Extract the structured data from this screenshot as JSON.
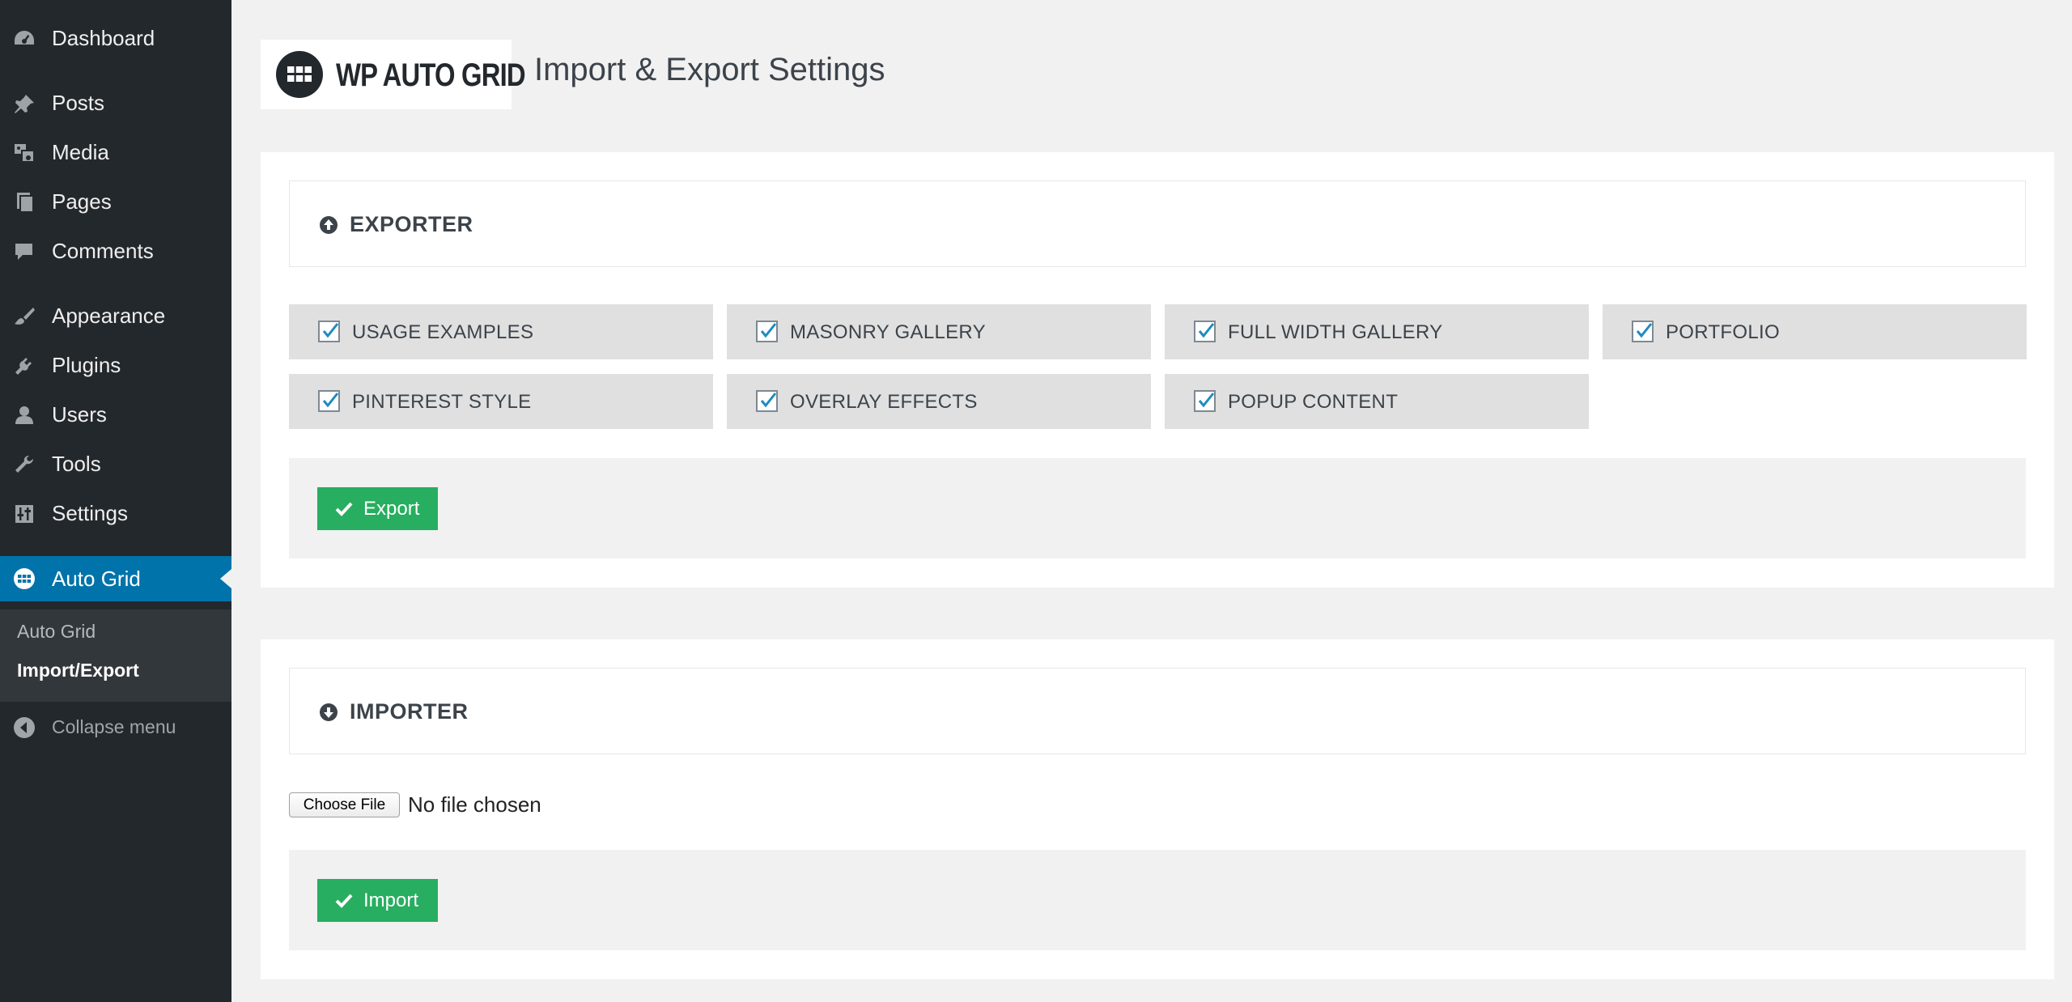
{
  "sidebar": {
    "items": [
      {
        "label": "Dashboard",
        "icon": "dashboard-icon"
      },
      {
        "label": "Posts",
        "icon": "pin-icon"
      },
      {
        "label": "Media",
        "icon": "media-icon"
      },
      {
        "label": "Pages",
        "icon": "pages-icon"
      },
      {
        "label": "Comments",
        "icon": "comment-icon"
      },
      {
        "label": "Appearance",
        "icon": "brush-icon"
      },
      {
        "label": "Plugins",
        "icon": "plug-icon"
      },
      {
        "label": "Users",
        "icon": "user-icon"
      },
      {
        "label": "Tools",
        "icon": "wrench-icon"
      },
      {
        "label": "Settings",
        "icon": "settings-icon"
      },
      {
        "label": "Auto Grid",
        "icon": "grid-icon",
        "active": true
      }
    ],
    "submenu": [
      {
        "label": "Auto Grid"
      },
      {
        "label": "Import/Export",
        "current": true
      }
    ],
    "collapse_label": "Collapse menu",
    "active_color": "#0073aa"
  },
  "header": {
    "logo_text": "WP AUTO GRID",
    "title": "Import & Export Settings"
  },
  "exporter": {
    "title": "EXPORTER",
    "options": [
      {
        "label": "USAGE EXAMPLES",
        "checked": true
      },
      {
        "label": "MASONRY GALLERY",
        "checked": true
      },
      {
        "label": "FULL WIDTH GALLERY",
        "checked": true
      },
      {
        "label": "PORTFOLIO",
        "checked": true
      },
      {
        "label": "PINTEREST STYLE",
        "checked": true
      },
      {
        "label": "OVERLAY EFFECTS",
        "checked": true
      },
      {
        "label": "POPUP CONTENT",
        "checked": true
      }
    ],
    "button_label": "Export"
  },
  "importer": {
    "title": "IMPORTER",
    "choose_file_label": "Choose File",
    "file_status": "No file chosen",
    "button_label": "Import"
  },
  "colors": {
    "button_green": "#27ae60",
    "sidebar_bg": "#23282d",
    "checkmark": "#1e8cbe"
  }
}
